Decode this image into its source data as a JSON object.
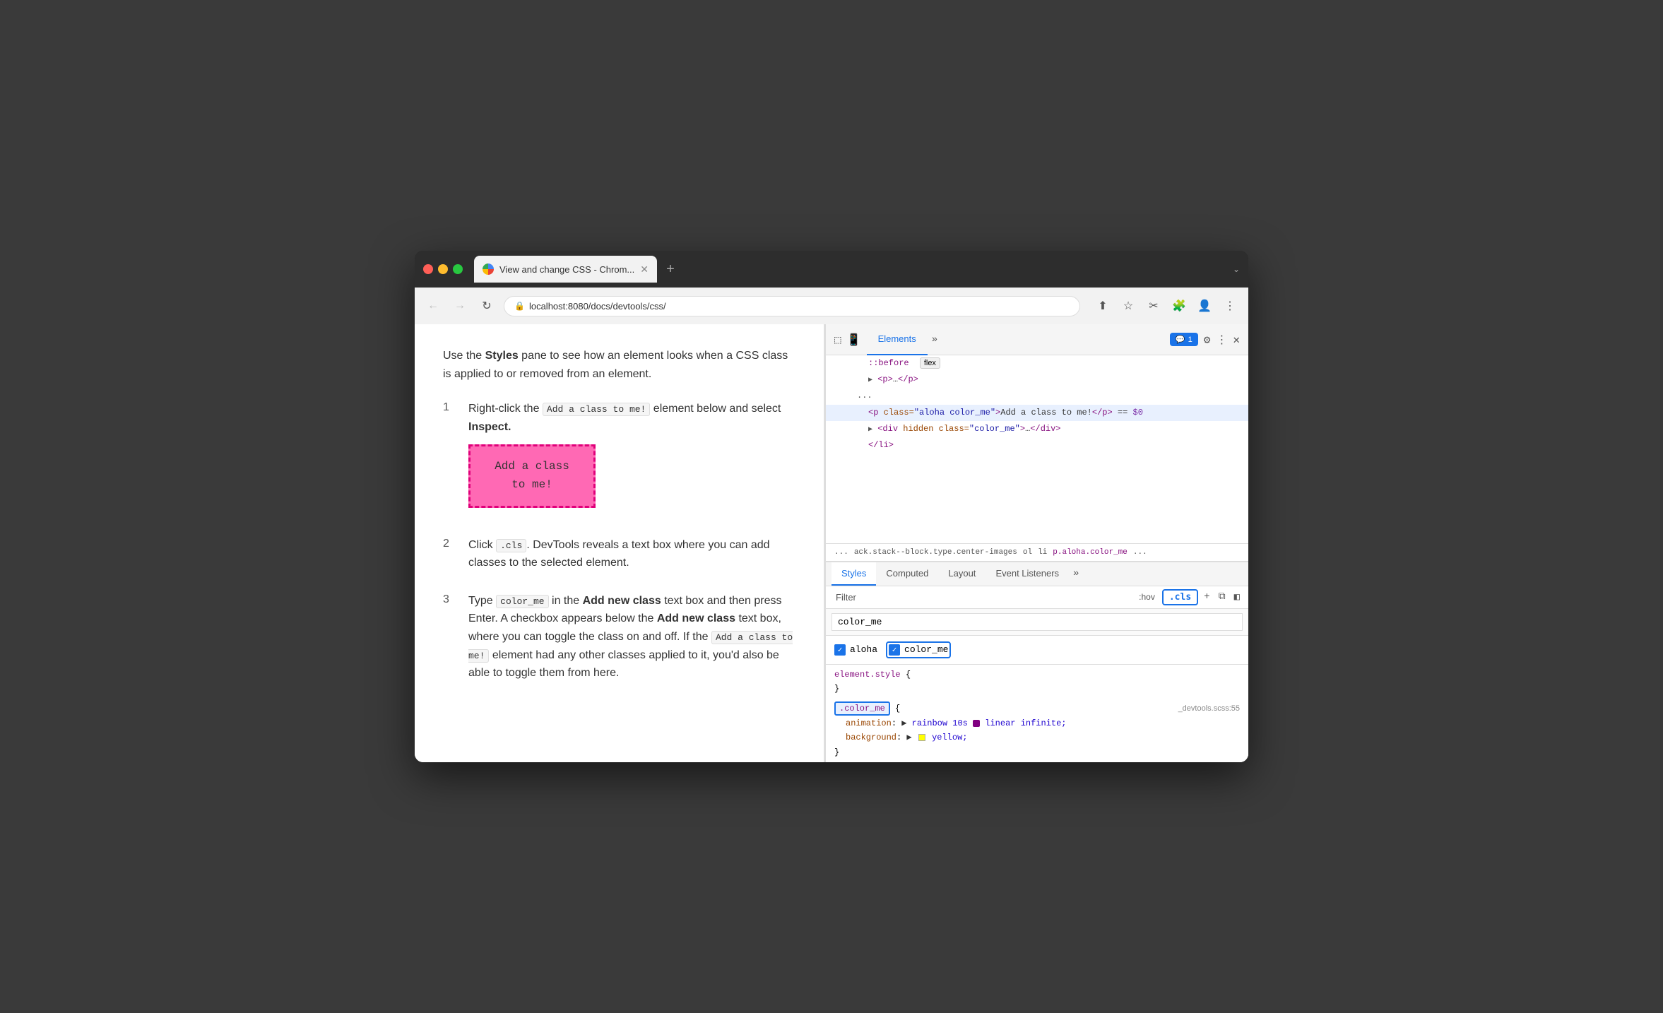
{
  "browser": {
    "tab_title": "View and change CSS - Chrom...",
    "url": "localhost:8080/docs/devtools/css/",
    "nav": {
      "back_disabled": true,
      "forward_disabled": true
    }
  },
  "doc": {
    "intro": "Use the Styles pane to see how an element looks when a CSS class is applied to or removed from an element.",
    "steps": [
      {
        "number": "1",
        "text_before": "Right-click the ",
        "code": "Add a class to me!",
        "text_after": " element below and select ",
        "bold": "Inspect."
      },
      {
        "number": "2",
        "text_before": "Click ",
        "code": ".cls",
        "text_middle": ". DevTools reveals a text box where you can add classes to the selected element."
      },
      {
        "number": "3",
        "text_before": "Type ",
        "code": "color_me",
        "text_middle": " in the ",
        "bold1": "Add new class",
        "text_middle2": " text box and then press Enter. A checkbox appears below the ",
        "bold2": "Add new class",
        "text_after": " text box, where you can toggle the class on and off. If the ",
        "code2": "Add a class to me!",
        "text_final": " element had any other classes applied to it, you'd also be able to toggle them from here."
      }
    ],
    "button_label": "Add a class to me!"
  },
  "devtools": {
    "panels": [
      "Elements",
      "»"
    ],
    "active_panel": "Elements",
    "actions": {
      "chat_badge": "1",
      "icons": [
        "gear",
        "more",
        "close"
      ]
    },
    "html": {
      "lines": [
        {
          "indent": 2,
          "content": "::before",
          "type": "pseudo",
          "extra": "flex"
        },
        {
          "indent": 2,
          "content": "<p>…</p>",
          "type": "collapsed"
        },
        {
          "indent": 1,
          "content": "...",
          "type": "dots"
        },
        {
          "indent": 2,
          "content": "<p class=\"aloha color_me\">Add a class to me!</p> == $0",
          "type": "selected"
        },
        {
          "indent": 2,
          "content": "<div hidden class=\"color_me\">…</div>",
          "type": "collapsed"
        },
        {
          "indent": 2,
          "content": "</li>",
          "type": "tag"
        }
      ]
    },
    "breadcrumb": [
      "...",
      "ack.stack--block.type.center-images",
      "ol",
      "li",
      "p.aloha.color_me",
      "..."
    ],
    "styles": {
      "tabs": [
        "Styles",
        "Computed",
        "Layout",
        "Event Listeners",
        "»"
      ],
      "active_tab": "Styles",
      "filter_placeholder": "Filter",
      "hov_label": ":hov",
      "cls_label": ".cls",
      "class_input_value": "color_me",
      "checkboxes": [
        {
          "label": "aloha",
          "checked": true
        },
        {
          "label": "color_me",
          "checked": true,
          "highlighted": true
        }
      ],
      "rules": [
        {
          "selector": "element.style",
          "source": "",
          "properties": [
            {
              "open_brace": true
            },
            {
              "close_brace": true
            }
          ]
        },
        {
          "selector": ".color_me",
          "source": "_devtools.scss:55",
          "highlighted": true,
          "properties": [
            {
              "name": "animation",
              "value": "▶ rainbow 10s 🟪 linear infinite;"
            },
            {
              "name": "background",
              "value": "▶ 🟨 yellow;"
            }
          ]
        }
      ]
    }
  }
}
